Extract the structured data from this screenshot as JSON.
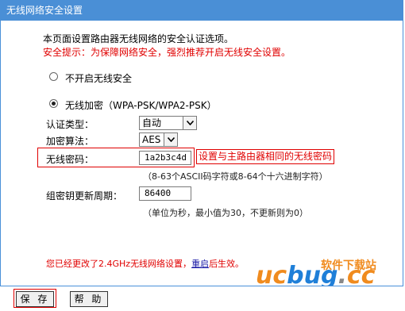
{
  "title": "无线网络安全设置",
  "intro": "本页面设置路由器无线网络的安全认证选项。",
  "security_tip": "安全提示：为保障网络安全，强烈推荐开启无线安全设置。",
  "options": {
    "no_security_label": "不开启无线安全",
    "encrypt_label": "无线加密（WPA-PSK/WPA2-PSK）",
    "selected": "encrypt"
  },
  "auth_type": {
    "label": "认证类型：",
    "value": "自动"
  },
  "encryption": {
    "label": "加密算法：",
    "value": "AES"
  },
  "password": {
    "label": "无线密码：",
    "value": "1a2b3c4d",
    "annotation": "设置与主路由器相同的无线密码",
    "hint": "（8-63个ASCII码字符或8-64个十六进制字符）"
  },
  "group_key": {
    "label": "组密钥更新周期：",
    "value": "86400",
    "hint": "（单位为秒，最小值为30，不更新则为0）"
  },
  "notice": {
    "prefix": "您已经更改了2.4GHz无线网络设置，",
    "link": "重启",
    "suffix": "后生效。"
  },
  "buttons": {
    "save": "保 存",
    "help": "帮 助"
  },
  "watermark": {
    "cn": "软件下载站",
    "uc": "uc",
    "bug": "bug",
    "dot": ".",
    "cc": "cc"
  },
  "colors": {
    "title_bar": "#4a8fd6",
    "warning": "#e00000",
    "logo_orange": "#f08b1e",
    "logo_blue": "#1f7fd8"
  }
}
